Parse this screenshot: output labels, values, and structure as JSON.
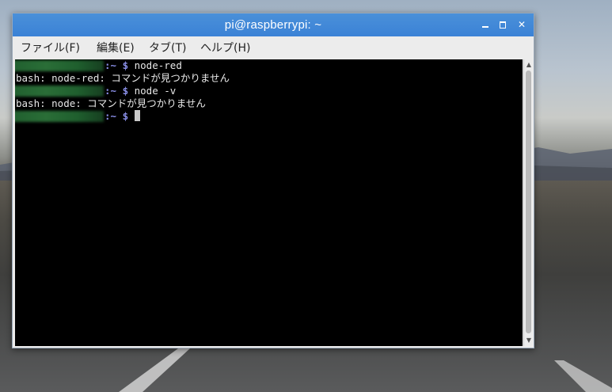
{
  "window": {
    "title": "pi@raspberrypi: ~",
    "minimize_icon": "minimize-icon",
    "maximize_icon": "maximize-icon",
    "close_glyph": "✕"
  },
  "menubar": {
    "items": [
      "ファイル(F)",
      "編集(E)",
      "タブ(T)",
      "ヘルプ(H)"
    ]
  },
  "terminal": {
    "lines": [
      {
        "prompt": ":~ $",
        "command": " node-red"
      },
      {
        "output": "bash: node-red: コマンドが見つかりません"
      },
      {
        "prompt": ":~ $",
        "command": " node -v"
      },
      {
        "output": "bash: node: コマンドが見つかりません"
      },
      {
        "prompt": ":~ $",
        "command": " "
      }
    ]
  },
  "colors": {
    "titlebar": "#3b82d6",
    "terminal_bg": "#000000",
    "prompt_accent": "#8a8fe8",
    "redaction": "#2a6e37"
  }
}
